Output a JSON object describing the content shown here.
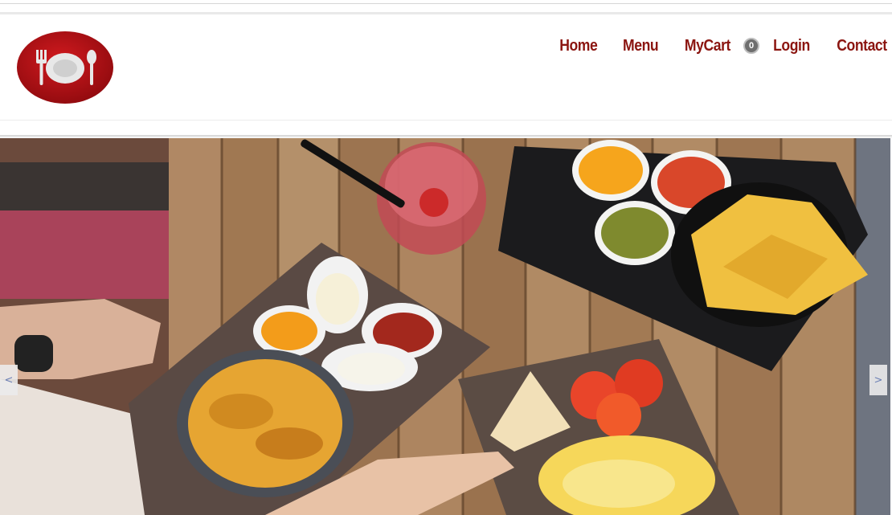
{
  "brand": {
    "logo_icon": "plate-fork-spoon-logo",
    "color": "#b00d12"
  },
  "nav": {
    "home": "Home",
    "menu": "Menu",
    "cart": "MyCart",
    "cart_count": "0",
    "login": "Login",
    "contact": "Contact"
  },
  "hero": {
    "image": "food-table-photo",
    "prev_label": "<",
    "next_label": ">"
  },
  "colors": {
    "nav_text": "#8b1510",
    "badge": "#6e6e6e"
  }
}
